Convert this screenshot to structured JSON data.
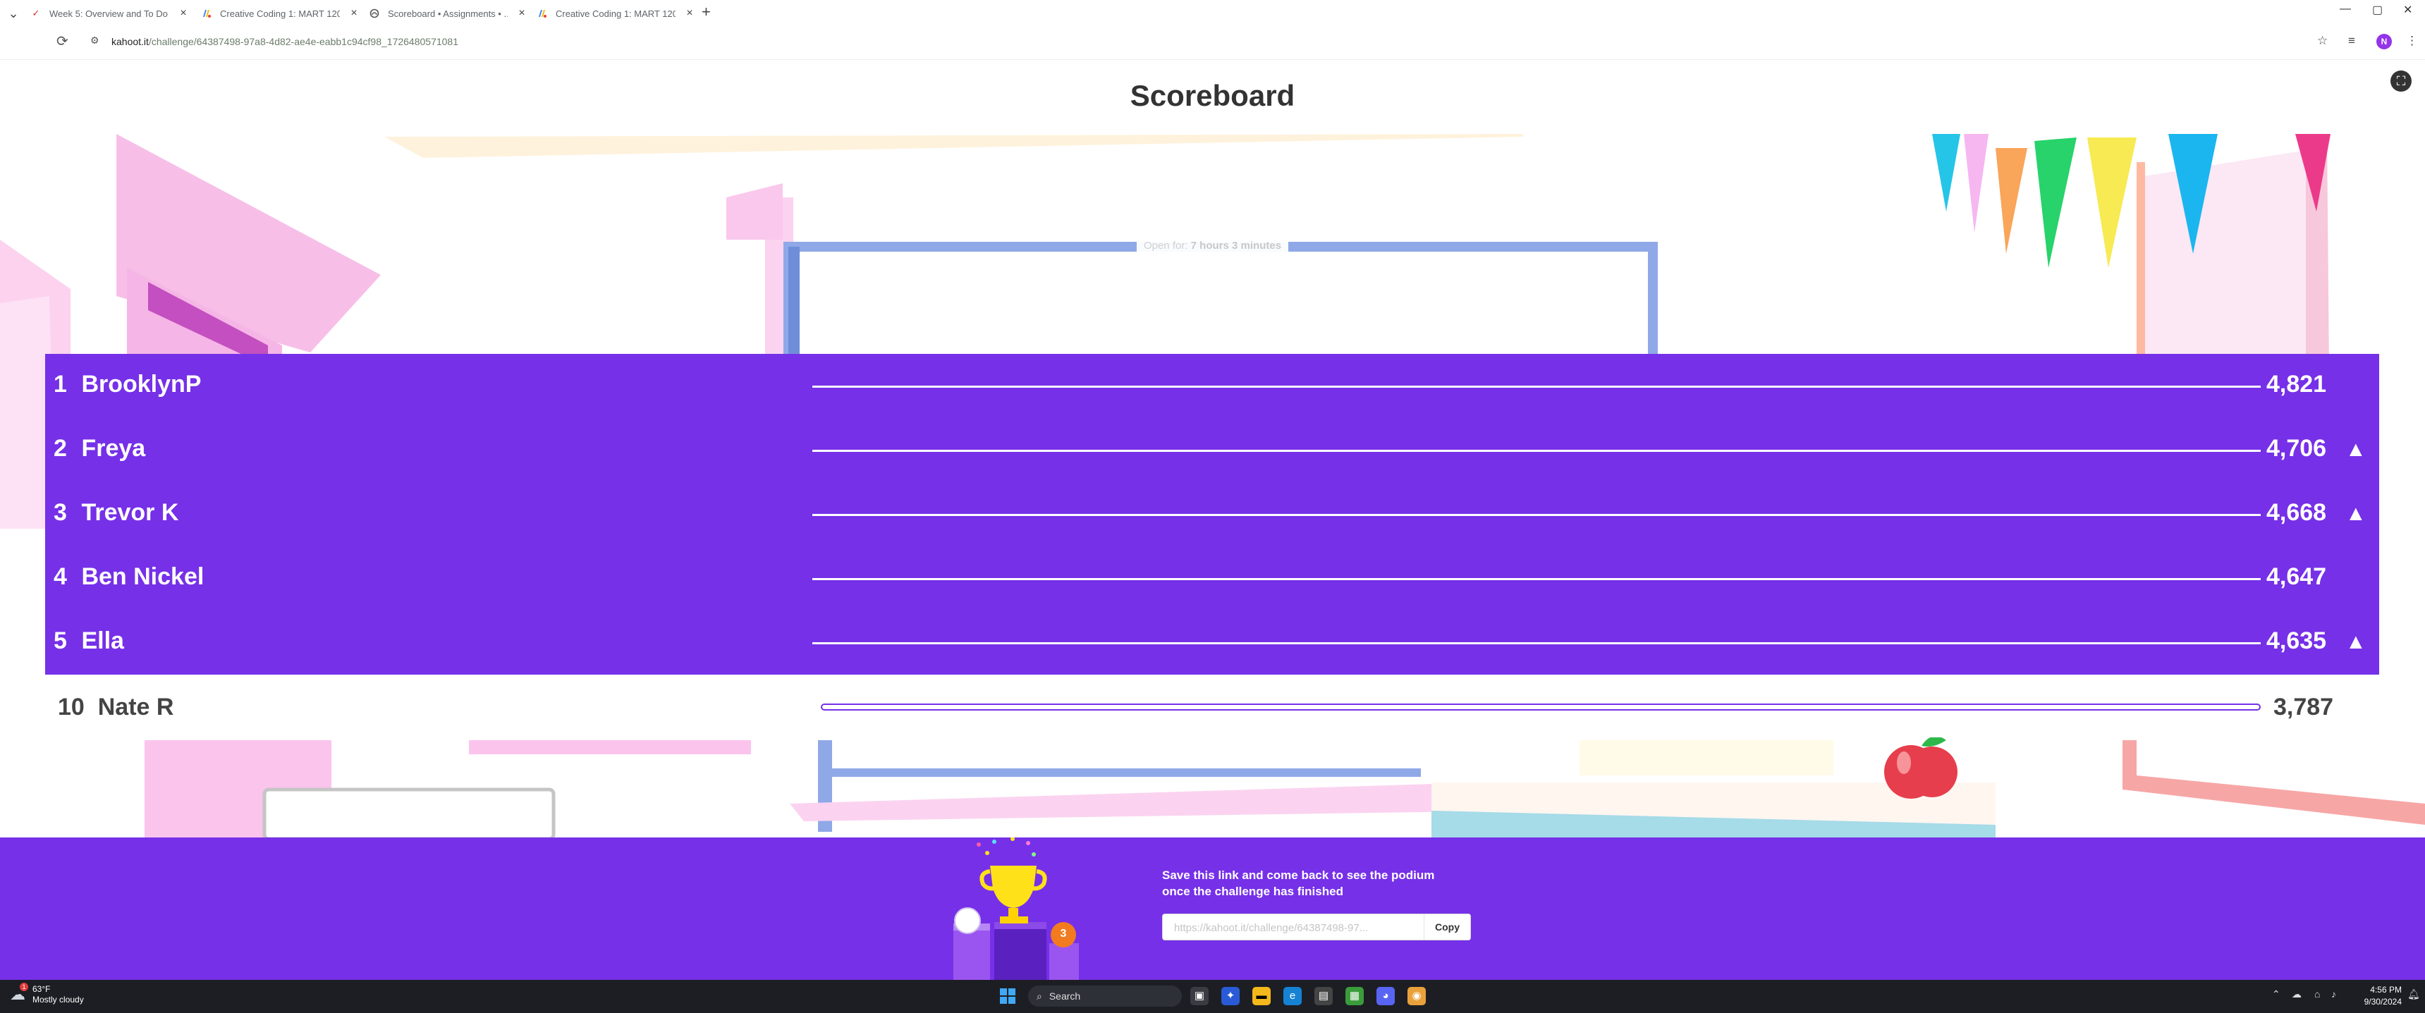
{
  "browser": {
    "tabs": [
      {
        "title": "Week 5: Overview and To Do ...",
        "icon": "check-favicon"
      },
      {
        "title": "Creative Coding 1: MART 120",
        "icon": "google-favicon"
      },
      {
        "title": "Scoreboard • Assignments • ...",
        "icon": "kahoot-favicon"
      },
      {
        "title": "Creative Coding 1: MART 120",
        "icon": "google-favicon"
      }
    ],
    "url_host": "kahoot.it",
    "url_path": "/challenge/64387498-97a8-4d82-ae4e-eabb1c94cf98_1726480571081",
    "profile_initial": "N"
  },
  "page": {
    "title": "Scoreboard",
    "open_prefix": "Open for:",
    "open_duration": "7 hours 3 minutes"
  },
  "leaderboard": {
    "rows": [
      {
        "rank": "1",
        "name": "BrooklynP",
        "score": "4,821",
        "arrow": ""
      },
      {
        "rank": "2",
        "name": "Freya",
        "score": "4,706",
        "arrow": "▲"
      },
      {
        "rank": "3",
        "name": "Trevor K",
        "score": "4,668",
        "arrow": "▲"
      },
      {
        "rank": "4",
        "name": "Ben Nickel",
        "score": "4,647",
        "arrow": ""
      },
      {
        "rank": "5",
        "name": "Ella",
        "score": "4,635",
        "arrow": "▲"
      }
    ],
    "me": {
      "rank": "10",
      "name": "Nate R",
      "score": "3,787"
    }
  },
  "footer": {
    "line1": "Save this link and come back to see the podium",
    "line2": "once the challenge has finished",
    "link_placeholder": "https://kahoot.it/challenge/64387498-97...",
    "copy_label": "Copy",
    "podium_badge": "3"
  },
  "taskbar": {
    "weather_temp": "63°F",
    "weather_desc": "Mostly cloudy",
    "weather_badge": "1",
    "search_label": "Search",
    "time": "4:56 PM",
    "date": "9/30/2024"
  },
  "colors": {
    "kahoot_purple": "#7630e8",
    "taskbar": "#1d1e24"
  }
}
